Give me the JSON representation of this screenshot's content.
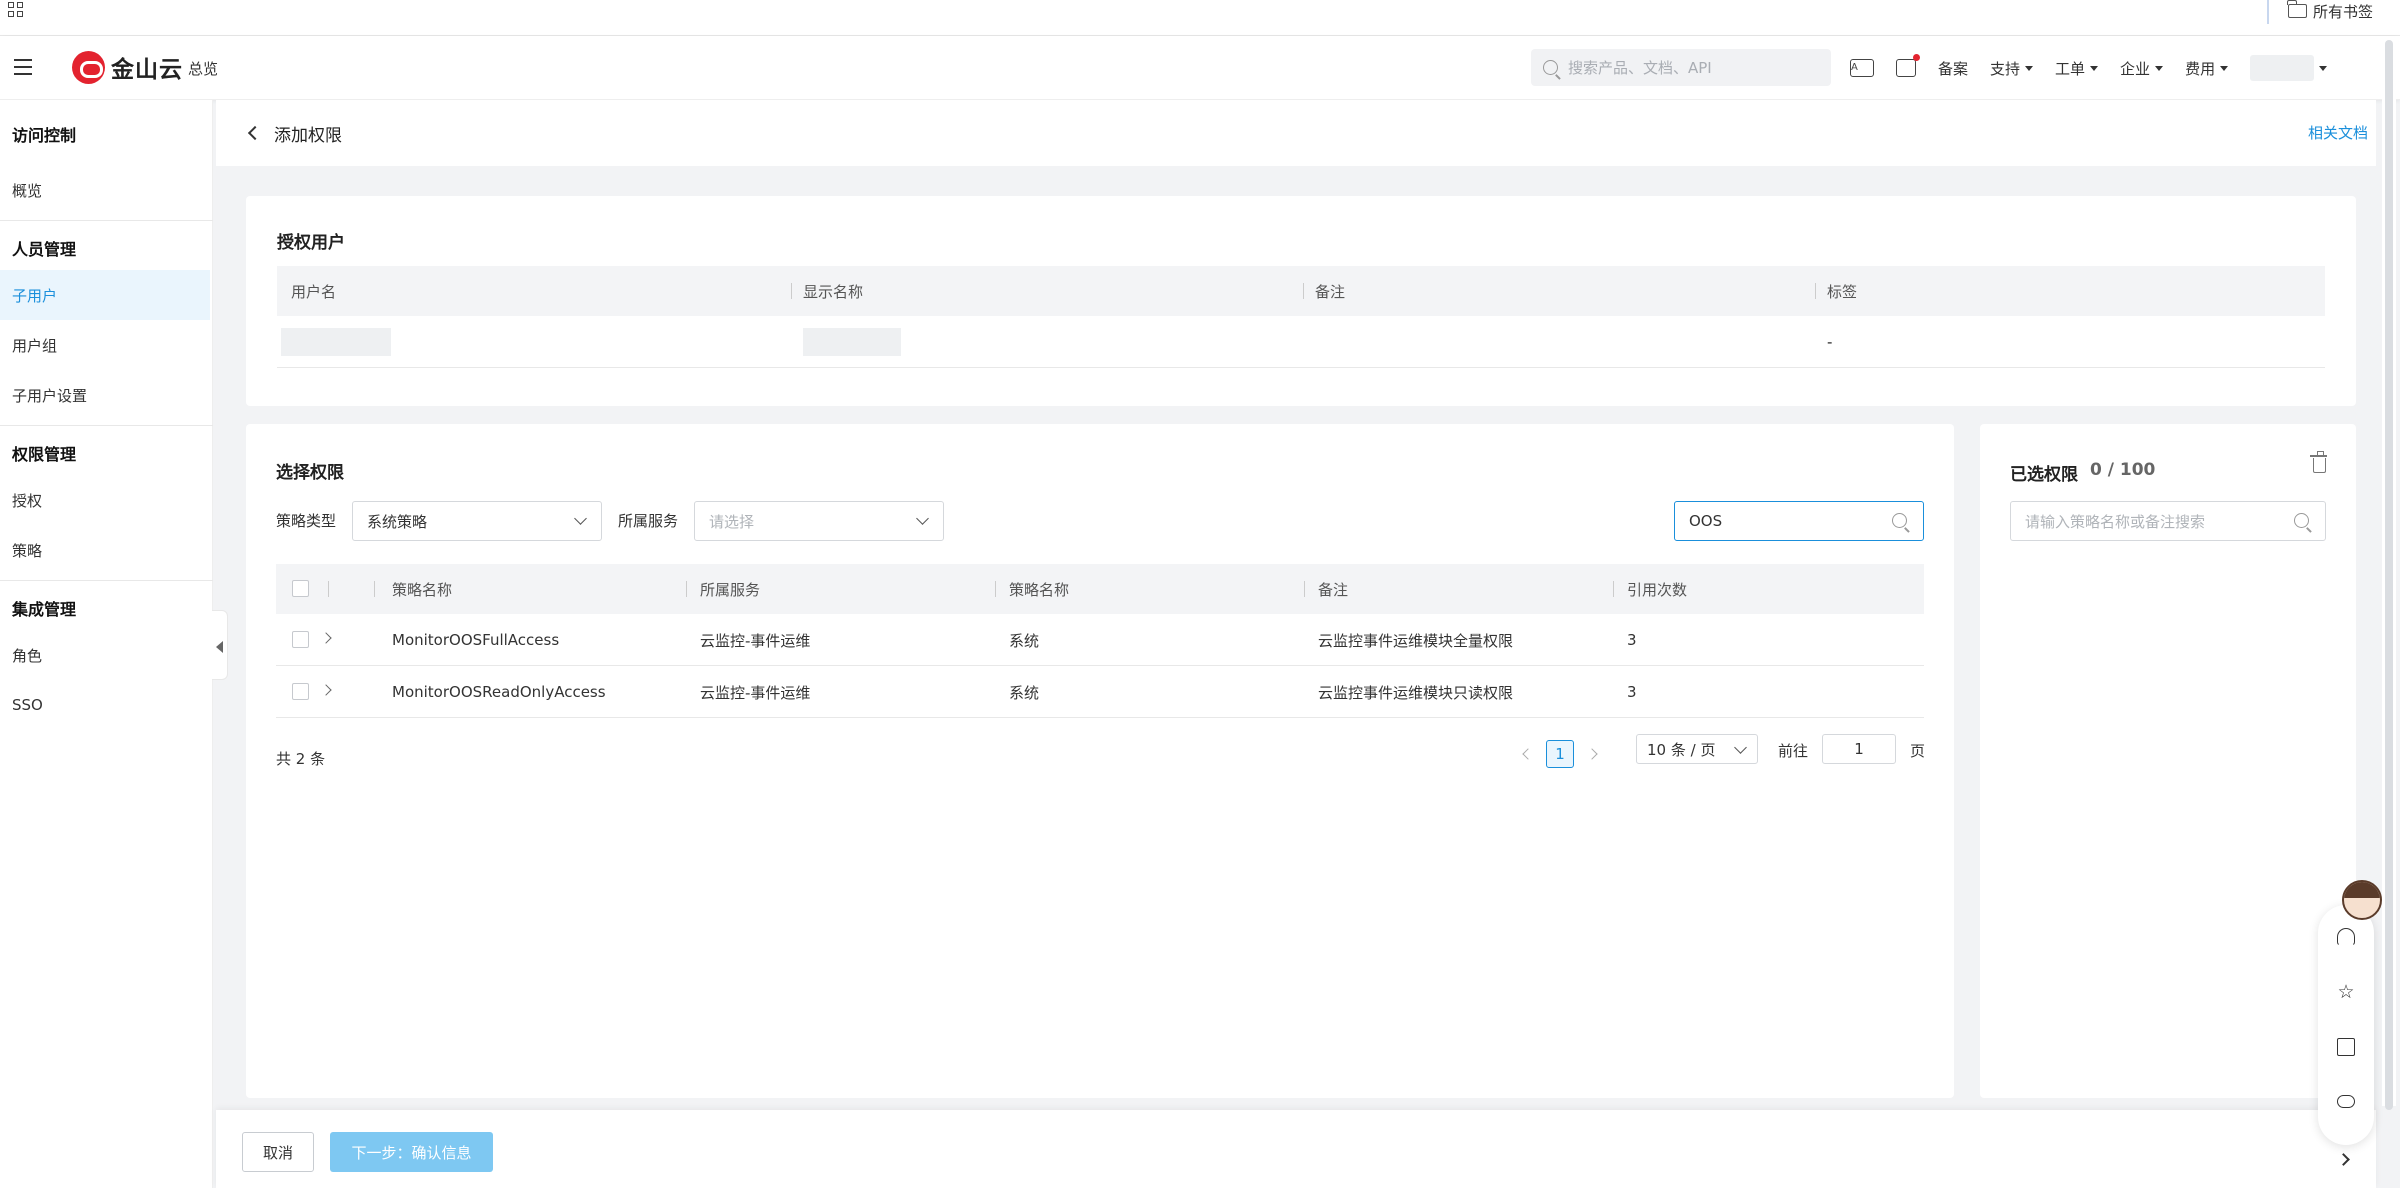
{
  "bookmark_bar": {
    "all_bookmarks": "所有书签"
  },
  "topnav": {
    "logo_text": "金山云",
    "overview": "总览",
    "search_placeholder": "搜索产品、文档、API",
    "items": {
      "record": "备案",
      "support": "支持",
      "ticket": "工单",
      "enterprise": "企业",
      "billing": "费用"
    }
  },
  "sidebar": {
    "title": "访问控制",
    "overview": "概览",
    "section_people": "人员管理",
    "subuser": "子用户",
    "usergroup": "用户组",
    "subuser_settings": "子用户设置",
    "section_perm": "权限管理",
    "grant": "授权",
    "policy": "策略",
    "section_integration": "集成管理",
    "role": "角色",
    "sso": "SSO"
  },
  "page": {
    "title": "添加权限",
    "related_docs": "相关文档"
  },
  "auth_user": {
    "title": "授权用户",
    "columns": [
      "用户名",
      "显示名称",
      "备注",
      "标签"
    ],
    "row": {
      "tag": "-"
    }
  },
  "select_perm": {
    "title": "选择权限",
    "policy_type_label": "策略类型",
    "policy_type_value": "系统策略",
    "service_label": "所属服务",
    "service_placeholder": "请选择",
    "search_value": "OOS",
    "columns": [
      "策略名称",
      "所属服务",
      "策略名称",
      "备注",
      "引用次数"
    ],
    "rows": [
      {
        "name": "MonitorOOSFullAccess",
        "service": "云监控-事件运维",
        "type": "系统",
        "remark": "云监控事件运维模块全量权限",
        "count": "3"
      },
      {
        "name": "MonitorOOSReadOnlyAccess",
        "service": "云监控-事件运维",
        "type": "系统",
        "remark": "云监控事件运维模块只读权限",
        "count": "3"
      }
    ],
    "total": "共 2 条",
    "pager": {
      "current": "1",
      "page_size": "10 条 / 页",
      "goto_label": "前往",
      "goto_value": "1",
      "page_suffix": "页"
    }
  },
  "selected": {
    "title": "已选权限",
    "count": "0 / 100",
    "search_placeholder": "请输入策略名称或备注搜索"
  },
  "footer": {
    "cancel": "取消",
    "next": "下一步：确认信息"
  }
}
